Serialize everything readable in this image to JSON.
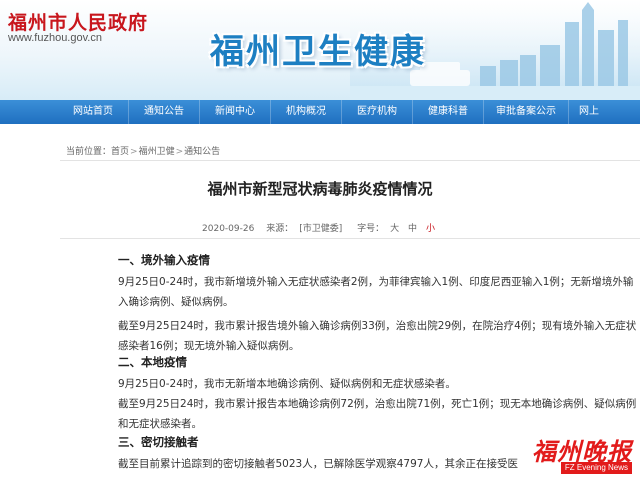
{
  "header": {
    "gov_title": "福州市人民政府",
    "gov_url": "www.fuzhou.gov.cn",
    "site_title": "福州卫生健康"
  },
  "nav": {
    "items": [
      "网站首页",
      "通知公告",
      "新闻中心",
      "机构概况",
      "医疗机构",
      "健康科普",
      "审批备案公示",
      "网上"
    ]
  },
  "breadcrumb": {
    "prefix": "当前位置：",
    "items": [
      "首页",
      "福州卫健",
      "通知公告"
    ]
  },
  "article": {
    "title": "福州市新型冠状病毒肺炎疫情情况",
    "date": "2020-09-26",
    "source_label": "来源：",
    "source": "[市卫健委]",
    "font_label": "字号：",
    "font_large": "大",
    "font_medium": "中",
    "font_small": "小",
    "sections": [
      {
        "heading": "一、境外输入疫情",
        "paragraphs": [
          "9月25日0-24时，我市新增境外输入无症状感染者2例，为菲律宾输入1例、印度尼西亚输入1例；无新增境外输入确诊病例、疑似病例。",
          "截至9月25日24时，我市累计报告境外输入确诊病例33例，治愈出院29例，在院治疗4例；现有境外输入无症状感染者16例；现无境外输入疑似病例。"
        ]
      },
      {
        "heading": "二、本地疫情",
        "paragraphs": [
          "9月25日0-24时，我市无新增本地确诊病例、疑似病例和无症状感染者。",
          "截至9月25日24时，我市累计报告本地确诊病例72例，治愈出院71例，死亡1例；现无本地确诊病例、疑似病例和无症状感染者。"
        ]
      },
      {
        "heading": "三、密切接触者",
        "paragraphs": [
          "截至目前累计追踪到的密切接触者5023人，已解除医学观察4797人，其余正在接受医学观察"
        ]
      }
    ]
  },
  "watermark": {
    "logo": "福州晚报",
    "sub": "FZ Evening News"
  },
  "colors": {
    "gov_red": "#c8161d",
    "nav_blue": "#1f6fc0",
    "site_title_blue": "#1d7fc2"
  }
}
